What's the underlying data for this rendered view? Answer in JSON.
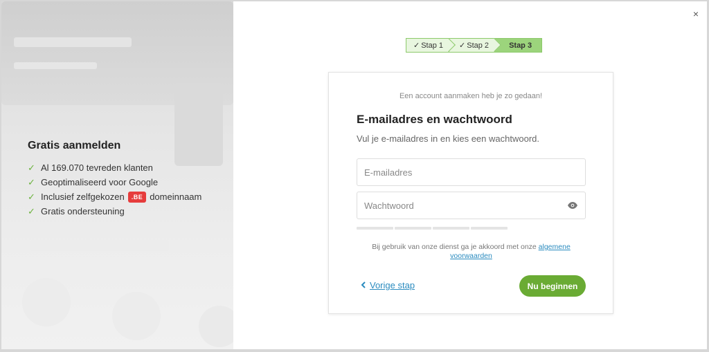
{
  "left": {
    "title": "Gratis aanmelden",
    "benefits": [
      {
        "text": "Al 169.070 tevreden klanten"
      },
      {
        "text": "Geoptimaliseerd voor Google"
      },
      {
        "pre": "Inclusief zelfgekozen",
        "badge": ".BE",
        "post": "domeinnaam"
      },
      {
        "text": "Gratis ondersteuning"
      }
    ],
    "check_glyph": "✓"
  },
  "close_label": "×",
  "steps": [
    {
      "label": "Stap 1",
      "state": "done",
      "tick": "✓"
    },
    {
      "label": "Stap 2",
      "state": "done",
      "tick": "✓"
    },
    {
      "label": "Stap 3",
      "state": "active"
    }
  ],
  "card": {
    "subtitle": "Een account aanmaken heb je zo gedaan!",
    "title": "E-mailadres en wachtwoord",
    "description": "Vul je e-mailadres in en kies een wachtwoord.",
    "email_placeholder": "E-mailadres",
    "email_value": "",
    "password_placeholder": "Wachtwoord",
    "password_value": "",
    "password_strength_segments": 4,
    "password_strength_filled": 0,
    "terms_text": "Bij gebruik van onze dienst ga je akkoord met onze",
    "terms_link": "algemene voorwaarden",
    "back_label": "Vorige stap",
    "submit_label": "Nu beginnen"
  },
  "colors": {
    "accent_green": "#6aab34",
    "check_green": "#6cb33f",
    "link_blue": "#2a8bbf",
    "badge_red": "#e63c3c",
    "step_done_bg": "#e8f6df",
    "step_active_bg": "#9cd47c"
  },
  "icons": {
    "close": "close-icon",
    "check": "check-icon",
    "eye": "eye-icon",
    "back": "chevron-left-icon"
  }
}
